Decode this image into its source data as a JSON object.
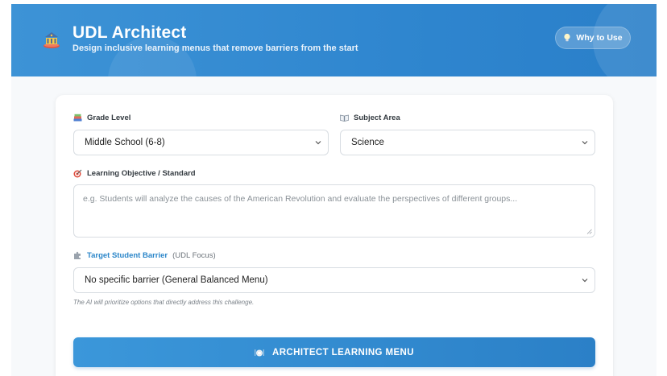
{
  "header": {
    "title": "UDL Architect",
    "subtitle": "Design inclusive learning menus that remove barriers from the start",
    "why_button": "Why to Use",
    "logo_icon": "classical-building-icon",
    "colors": {
      "header": "#2f86cf",
      "accent": "#2b86c9"
    }
  },
  "form": {
    "grade": {
      "label": "Grade Level",
      "value": "Middle School (6-8)",
      "icon": "books-icon"
    },
    "subject": {
      "label": "Subject Area",
      "value": "Science",
      "icon": "open-book-icon"
    },
    "objective": {
      "label": "Learning Objective / Standard",
      "placeholder": "e.g. Students will analyze the causes of the American Revolution and evaluate the perspectives of different groups...",
      "icon": "target-icon"
    },
    "barrier": {
      "label": "Target Student Barrier",
      "label_sub": "(UDL Focus)",
      "value": "No specific barrier (General Balanced Menu)",
      "hint": "The AI will prioritize options that directly address this challenge.",
      "icon": "puzzle-icon"
    },
    "submit": {
      "label": "ARCHITECT LEARNING MENU",
      "icon": "plate-icon"
    }
  }
}
